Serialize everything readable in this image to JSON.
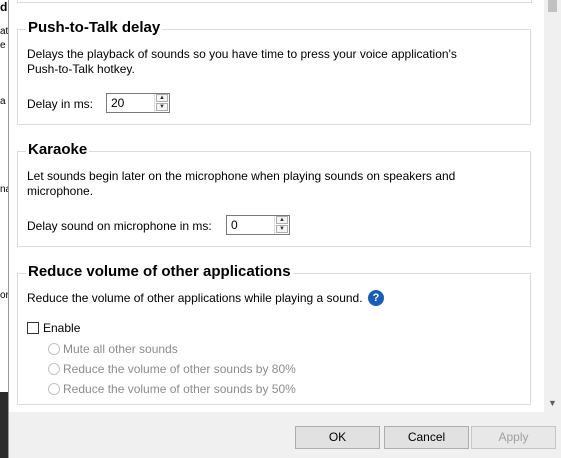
{
  "background_window": {
    "fragments": [
      "d",
      "at",
      "e",
      "a",
      "na",
      "or"
    ]
  },
  "push_to_talk": {
    "title": "Push-to-Talk delay",
    "description_line1": "Delays the playback of sounds so you have time to press your voice application's",
    "description_line2": "Push-to-Talk hotkey.",
    "delay_label": "Delay in ms:",
    "delay_value": "20"
  },
  "karaoke": {
    "title": "Karaoke",
    "description_line1": "Let sounds begin later on the microphone when playing sounds on speakers and",
    "description_line2": "microphone.",
    "delay_label": "Delay sound on microphone in ms:",
    "delay_value": "0"
  },
  "reduce_volume": {
    "title": "Reduce volume of other applications",
    "description": "Reduce the volume of other applications while playing a sound.",
    "help_glyph": "?",
    "enable_label": "Enable",
    "enable_checked": false,
    "options": [
      "Mute all other sounds",
      "Reduce the volume of other sounds by 80%",
      "Reduce the volume of other sounds by 50%"
    ]
  },
  "footer": {
    "ok_label": "OK",
    "cancel_label": "Cancel",
    "apply_label": "Apply"
  },
  "colors": {
    "help_icon": "#1a5db5",
    "group_border": "#dcdcdc"
  }
}
